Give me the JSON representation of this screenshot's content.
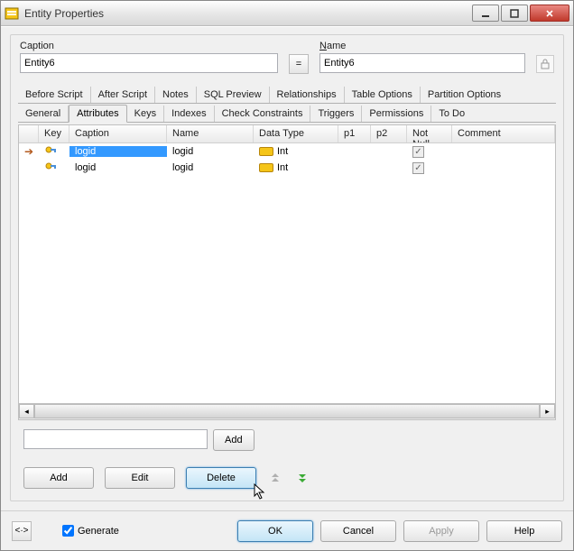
{
  "window": {
    "title": "Entity Properties"
  },
  "fields": {
    "caption_label": "Caption",
    "caption_value": "Entity6",
    "eq_label": "=",
    "name_label_pre": "N",
    "name_label_rest": "ame",
    "name_value": "Entity6"
  },
  "tabs": {
    "row1": [
      "Before Script",
      "After Script",
      "Notes",
      "SQL Preview",
      "Relationships",
      "Table Options",
      "Partition Options"
    ],
    "row2": [
      "General",
      "Attributes",
      "Keys",
      "Indexes",
      "Check Constraints",
      "Triggers",
      "Permissions",
      "To Do"
    ],
    "active": "Attributes"
  },
  "grid": {
    "headers": {
      "key": "Key",
      "caption": "Caption",
      "name": "Name",
      "dtype": "Data Type",
      "p1": "p1",
      "p2": "p2",
      "nn": "Not Null",
      "comment": "Comment"
    },
    "rows": [
      {
        "selected": true,
        "caption": "logid",
        "name": "logid",
        "dtype": "Int",
        "nn": true
      },
      {
        "selected": false,
        "caption": "logid",
        "name": "logid",
        "dtype": "Int",
        "nn": true
      }
    ]
  },
  "inlineAdd": {
    "button": "Add"
  },
  "actions": {
    "add": "Add",
    "edit": "Edit",
    "delete": "Delete"
  },
  "bottom": {
    "generate": "Generate",
    "ok": "OK",
    "cancel": "Cancel",
    "apply": "Apply",
    "help": "Help",
    "corner": "<·>"
  }
}
